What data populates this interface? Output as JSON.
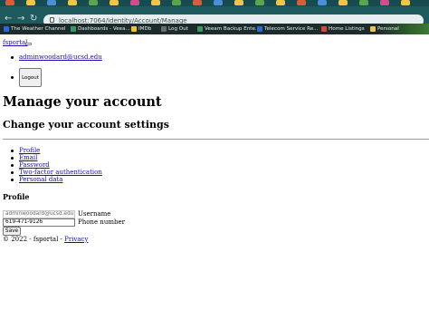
{
  "browser": {
    "url": "localhost:7064/Identity/Account/Manage",
    "nav_icons": [
      "back-icon",
      "forward-icon",
      "reload-icon"
    ],
    "tab_colors": [
      "#e05a3a",
      "#f4c542",
      "#4a90d9",
      "#f4c542",
      "#5aa64a",
      "#f4c542",
      "#d94a8c",
      "#f4c542",
      "#5aa64a",
      "#e05a3a",
      "#4a90d9",
      "#f4c542",
      "#5aa64a",
      "#f4c542",
      "#e05a3a",
      "#4a90d9",
      "#f4c542",
      "#5aa64a",
      "#d94a8c",
      "#f4c542"
    ],
    "bookmarks": [
      {
        "label": "The Weather Channel",
        "color": "#2a6bd4"
      },
      {
        "label": "Dashboards - Veea...",
        "color": "#3b9a5a"
      },
      {
        "label": "IMDb",
        "color": "#f5c518"
      },
      {
        "label": "Log Out",
        "color": "#6b6b6b"
      },
      {
        "label": "Veeam Backup Ente...",
        "color": "#3b9a5a"
      },
      {
        "label": "Telecom Service Re...",
        "color": "#2a6bd4"
      },
      {
        "label": "Home Listings",
        "color": "#d44a3a"
      },
      {
        "label": "Personal",
        "color": "#f4c542"
      }
    ]
  },
  "site": {
    "brand": "fsportal",
    "user_email": "adminwoodard@ucsd.edu",
    "logout_label": "Logout"
  },
  "main": {
    "title": "Manage your account",
    "subtitle": "Change your account settings",
    "nav": [
      "Profile",
      "Email",
      "Password",
      "Two-factor authentication",
      "Personal data"
    ],
    "section_title": "Profile",
    "username_value": "adminwoodard@ucsd.edu",
    "username_label": "Username",
    "phone_value": "619-471-9126",
    "phone_label": "Phone number",
    "save_label": "Save"
  },
  "footer": {
    "text": "© 2022 - fsportal - ",
    "privacy_link": "Privacy"
  }
}
